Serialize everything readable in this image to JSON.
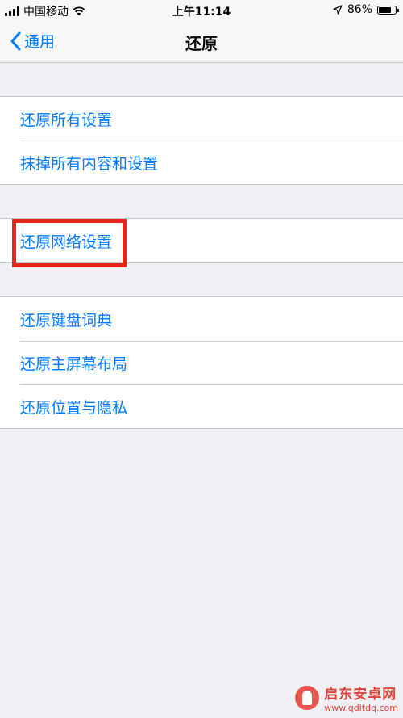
{
  "status_bar": {
    "carrier": "中国移动",
    "time": "上午11:14",
    "battery_percent": "86%",
    "battery_level": 0.86
  },
  "nav": {
    "back_label": "通用",
    "title": "还原"
  },
  "groups": [
    {
      "items": [
        "还原所有设置",
        "抹掉所有内容和设置"
      ]
    },
    {
      "items": [
        "还原网络设置"
      ]
    },
    {
      "items": [
        "还原键盘词典",
        "还原主屏幕布局",
        "还原位置与隐私"
      ]
    }
  ],
  "accent_color": "#007aff",
  "highlight_color": "#e5261f",
  "watermark": {
    "title": "启东安卓网",
    "url": "www.qdltdq.com"
  }
}
